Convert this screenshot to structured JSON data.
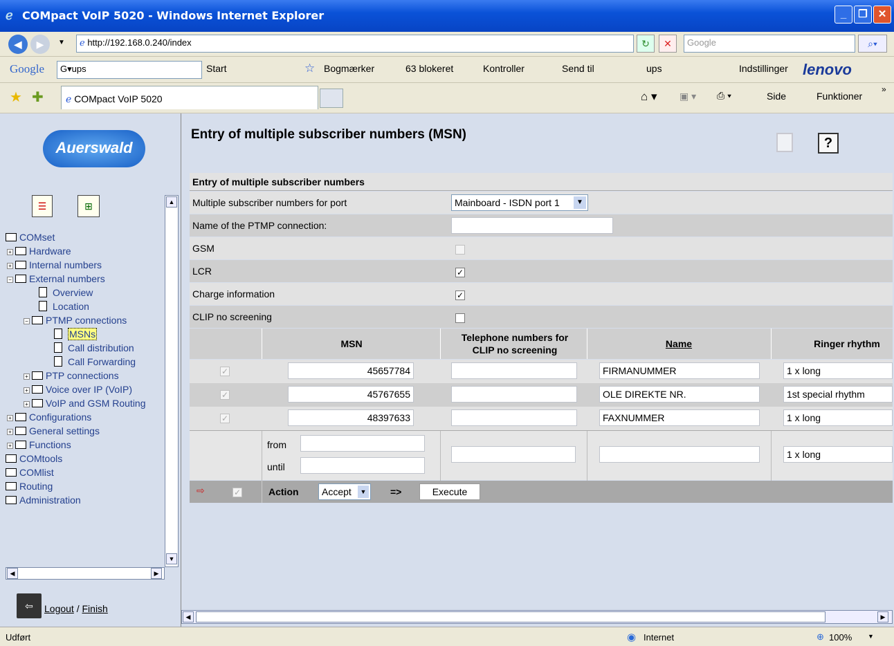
{
  "window": {
    "title": "COMpact VoIP 5020 - Windows Internet Explorer"
  },
  "address": {
    "url": "http://192.168.0.240/index",
    "search_placeholder": "Google"
  },
  "google_bar": {
    "brand": "Google",
    "query": "ups",
    "items": [
      "Start",
      "Bogmærker",
      "63 blokeret",
      "Kontroller",
      "Send til",
      "ups",
      "Indstillinger"
    ],
    "lenovo": "lenovo"
  },
  "tabs": {
    "active": "COMpact VoIP 5020",
    "tools": [
      "Side",
      "Funktioner"
    ]
  },
  "left": {
    "logo": "Auerswald",
    "tree": [
      "COMset",
      "Hardware",
      "Internal numbers",
      "External numbers",
      "Overview",
      "Location",
      "PTMP connections",
      "MSNs",
      "Call distribution",
      "Call Forwarding",
      "PTP connections",
      "Voice over IP (VoIP)",
      "VoIP and GSM Routing",
      "Configurations",
      "General settings",
      "Functions",
      "COMtools",
      "COMlist",
      "Routing",
      "Administration"
    ],
    "logout": "Logout",
    "finish": "Finish",
    "sep": "/"
  },
  "main": {
    "page_title": "Entry of multiple subscriber numbers (MSN)",
    "section_title": "Entry of multiple subscriber numbers",
    "port_label": "Multiple subscriber numbers for port",
    "port_value": "Mainboard - ISDN port 1",
    "ptmp_label": "Name of the PTMP connection:",
    "ptmp_value": "",
    "gsm_label": "GSM",
    "lcr_label": "LCR",
    "charge_label": "Charge information",
    "clip_label": "CLIP no screening",
    "columns": {
      "msn": "MSN",
      "tel": "Telephone numbers for CLIP no screening",
      "name": "Name",
      "ringer": "Ringer rhythm"
    },
    "rows": [
      {
        "msn": "45657784",
        "tel": "",
        "name": "FIRMANUMMER",
        "ringer": "1 x long"
      },
      {
        "msn": "45767655",
        "tel": "",
        "name": "OLE DIREKTE NR.",
        "ringer": "1st special rhythm"
      },
      {
        "msn": "48397633",
        "tel": "",
        "name": "FAXNUMMER",
        "ringer": "1 x long"
      }
    ],
    "new_row": {
      "from": "from",
      "until": "until",
      "ringer": "1 x long"
    },
    "action": {
      "label": "Action",
      "select": "Accept",
      "arrow": "=>",
      "execute": "Execute"
    }
  },
  "status": {
    "left": "Udført",
    "zone": "Internet",
    "zoom": "100%"
  }
}
